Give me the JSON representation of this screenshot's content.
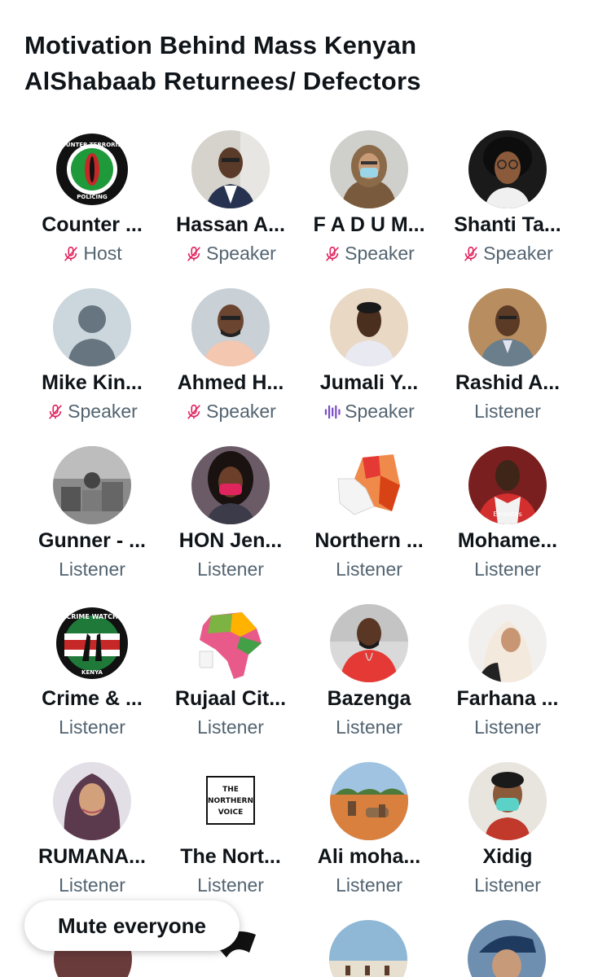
{
  "space": {
    "title_line1": "Motivation Behind Mass Kenyan",
    "title_line2": "AlShabaab Returnees/ Defectors"
  },
  "colors": {
    "muted_icon": "#e0245e",
    "speaking_icon": "#794bc4",
    "role_text": "#536471"
  },
  "participants": [
    {
      "name": "Counter ...",
      "role": "Host",
      "icon": "mic-muted-icon"
    },
    {
      "name": "Hassan A...",
      "role": "Speaker",
      "icon": "mic-muted-icon"
    },
    {
      "name": "F A D U M...",
      "role": "Speaker",
      "icon": "mic-muted-icon"
    },
    {
      "name": "Shanti Ta...",
      "role": "Speaker",
      "icon": "mic-muted-icon"
    },
    {
      "name": "Mike Kin...",
      "role": "Speaker",
      "icon": "mic-muted-icon"
    },
    {
      "name": "Ahmed H...",
      "role": "Speaker",
      "icon": "mic-muted-icon"
    },
    {
      "name": "Jumali Y...",
      "role": "Speaker",
      "icon": "speaking-waveform-icon"
    },
    {
      "name": "Rashid A...",
      "role": "Listener",
      "icon": ""
    },
    {
      "name": "Gunner - ...",
      "role": "Listener",
      "icon": ""
    },
    {
      "name": "HON Jen...",
      "role": "Listener",
      "icon": ""
    },
    {
      "name": "Northern ...",
      "role": "Listener",
      "icon": ""
    },
    {
      "name": "Mohame...",
      "role": "Listener",
      "icon": ""
    },
    {
      "name": "Crime & ...",
      "role": "Listener",
      "icon": ""
    },
    {
      "name": "Rujaal Cit...",
      "role": "Listener",
      "icon": ""
    },
    {
      "name": "Bazenga",
      "role": "Listener",
      "icon": ""
    },
    {
      "name": "Farhana ...",
      "role": "Listener",
      "icon": ""
    },
    {
      "name": "RUMANA...",
      "role": "Listener",
      "icon": ""
    },
    {
      "name": "The Nort...",
      "role": "Listener",
      "icon": ""
    },
    {
      "name": "Ali moha...",
      "role": "Listener",
      "icon": ""
    },
    {
      "name": "Xidig",
      "role": "Listener",
      "icon": ""
    }
  ],
  "logos": {
    "counter_top": "COUNTER TERRORISM",
    "counter_bottom": "POLICING",
    "crime_top": "CRIME WATCH",
    "crime_bottom": "KENYA",
    "northern_voice_1": "THE",
    "northern_voice_2": "NORTHERN",
    "northern_voice_3": "VOICE"
  },
  "actions": {
    "mute_everyone": "Mute everyone"
  }
}
